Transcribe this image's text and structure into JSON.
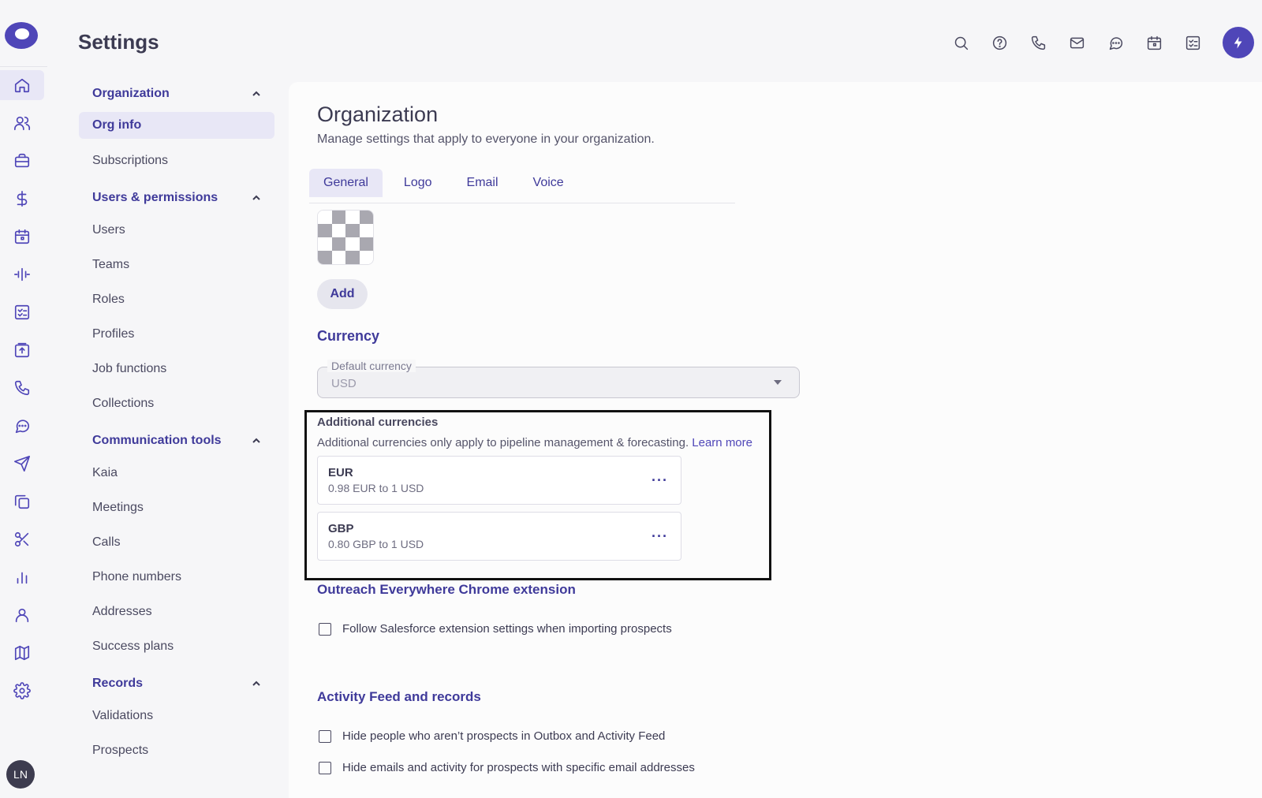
{
  "app": {
    "title": "Settings"
  },
  "rail": {
    "items": [
      "home-icon",
      "people-icon",
      "briefcase-icon",
      "dollar-icon",
      "calendar-icon",
      "waveform-icon",
      "checklist-icon",
      "upload-icon",
      "phone-icon",
      "chat-icon",
      "send-icon",
      "copy-icon",
      "scissors-icon",
      "bar-chart-icon",
      "person-icon",
      "map-icon",
      "gear-icon"
    ],
    "avatar_initials": "LN"
  },
  "topbar": {
    "icons": [
      "search-icon",
      "help-icon",
      "phone-icon",
      "mail-icon",
      "chat-icon",
      "calendar-icon",
      "tasks-icon",
      "bolt-icon"
    ]
  },
  "nav": {
    "groups": [
      {
        "label": "Organization",
        "items": [
          "Org info",
          "Subscriptions"
        ]
      },
      {
        "label": "Users & permissions",
        "items": [
          "Users",
          "Teams",
          "Roles",
          "Profiles",
          "Job functions",
          "Collections"
        ]
      },
      {
        "label": "Communication tools",
        "items": [
          "Kaia",
          "Meetings",
          "Calls",
          "Phone numbers",
          "Addresses",
          "Success plans"
        ]
      },
      {
        "label": "Records",
        "items": [
          "Validations",
          "Prospects"
        ]
      }
    ],
    "active_item": "Org info"
  },
  "main": {
    "title": "Organization",
    "subtitle": "Manage settings that apply to everyone in your organization.",
    "tabs": [
      "General",
      "Logo",
      "Email",
      "Voice"
    ],
    "active_tab": "General",
    "add_label": "Add",
    "currency": {
      "title": "Currency",
      "default_label": "Default currency",
      "default_value": "USD"
    },
    "additional": {
      "title": "Additional currencies",
      "description": "Additional currencies only apply to pipeline management & forecasting.",
      "learn_more": "Learn more",
      "items": [
        {
          "code": "EUR",
          "rate": "0.98 EUR to 1 USD"
        },
        {
          "code": "GBP",
          "rate": "0.80 GBP to 1 USD"
        }
      ],
      "more_label": "···"
    },
    "chrome_ext": {
      "title": "Outreach Everywhere Chrome extension",
      "checkbox": "Follow Salesforce extension settings when importing prospects"
    },
    "activity": {
      "title": "Activity Feed and records",
      "checkboxes": [
        "Hide people who aren’t prospects in Outbox and Activity Feed",
        "Hide emails and activity for prospects with specific email addresses"
      ]
    }
  },
  "colors": {
    "accent": "#4f46b8",
    "nav_active_bg": "#e8e7f6"
  }
}
